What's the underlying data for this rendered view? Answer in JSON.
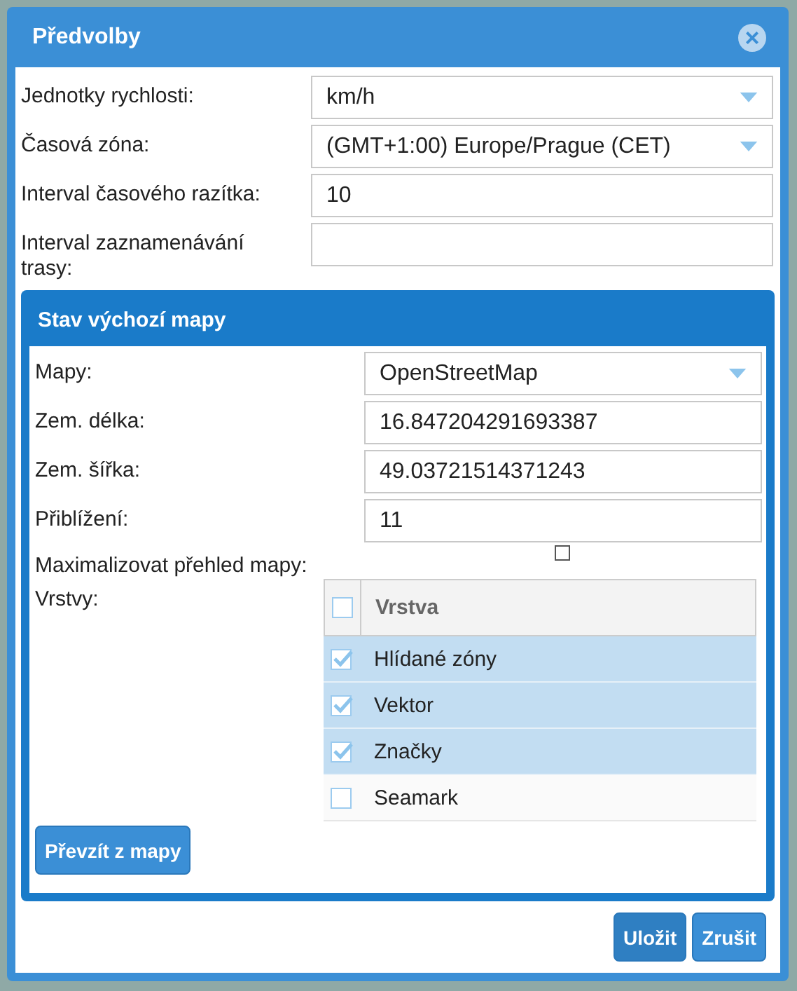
{
  "dialog": {
    "title": "Předvolby",
    "close": "×"
  },
  "fields": [
    {
      "label": "Jednotky rychlosti:",
      "kind": "select",
      "value": "km/h"
    },
    {
      "label": "Časová zóna:",
      "kind": "select",
      "value": "(GMT+1:00) Europe/Prague (CET)"
    },
    {
      "label": "Interval časového razítka:",
      "kind": "text",
      "value": "10"
    },
    {
      "label": "Interval zaznamenávání trasy:",
      "kind": "text"
    }
  ],
  "map_panel": {
    "title": "Stav výchozí mapy",
    "fields": [
      {
        "label": "Mapy:",
        "kind": "select",
        "value": "OpenStreetMap"
      },
      {
        "label": "Zem. délka:",
        "kind": "text",
        "value": "16.847204291693387"
      },
      {
        "label": "Zem. šířka:",
        "kind": "text",
        "value": "49.03721514371243"
      },
      {
        "label": "Přiblížení:",
        "kind": "text",
        "value": "11"
      }
    ],
    "maximize": {
      "label": "Maximalizovat přehled mapy:",
      "checked": false
    },
    "layers": {
      "label": "Vrstvy:",
      "header": {
        "label": "Vrstva",
        "checked": false
      },
      "rows": [
        {
          "name": "Hlídané zóny",
          "checked": true,
          "selected": true
        },
        {
          "name": "Vektor",
          "checked": true,
          "selected": true
        },
        {
          "name": "Značky",
          "checked": true,
          "selected": true
        },
        {
          "name": "Seamark",
          "checked": false,
          "selected": false
        }
      ]
    },
    "button": "Převzít z mapy"
  },
  "buttons": [
    "Uložit",
    "Zrušit"
  ]
}
